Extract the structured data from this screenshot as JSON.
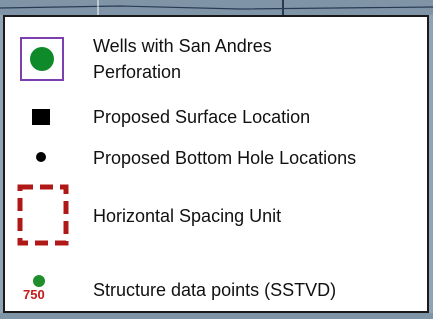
{
  "legend": {
    "items": [
      {
        "symbol": "green-circle-in-purple-box",
        "label_line1": "Wells with San Andres",
        "label_line2": "Perforation"
      },
      {
        "symbol": "black-square",
        "label": "Proposed Surface Location"
      },
      {
        "symbol": "black-dot",
        "label": "Proposed Bottom Hole Locations"
      },
      {
        "symbol": "red-dashed-rectangle",
        "label": "Horizontal Spacing Unit"
      },
      {
        "symbol": "green-dot-with-value",
        "label": "Structure data points (SSTVD)",
        "sample_value": "750"
      }
    ]
  },
  "colors": {
    "well_green": "#0f8a2a",
    "well_box_purple": "#7b3fb0",
    "spacing_unit_red": "#b01818",
    "structure_green": "#1e8f2a",
    "structure_value_red": "#c41a1a",
    "map_background": "#8fa4b4"
  }
}
